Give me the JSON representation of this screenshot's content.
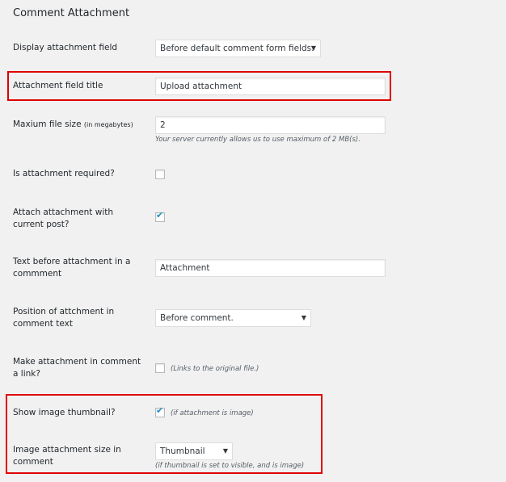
{
  "section_title": "Comment Attachment",
  "rows": {
    "display_field": {
      "label": "Display attachment field",
      "value": "Before default comment form fields."
    },
    "field_title": {
      "label": "Attachment field title",
      "value": "Upload attachment"
    },
    "max_size": {
      "label": "Maxium file size",
      "label_small": "(in megabytes)",
      "value": "2",
      "note": "Your server currently allows us to use maximum of 2 MB(s)."
    },
    "required": {
      "label": "Is attachment required?",
      "checked": false
    },
    "attach_post": {
      "label": "Attach attachment with current post?",
      "checked": true
    },
    "text_before": {
      "label": "Text before attachment in a commment",
      "value": "Attachment"
    },
    "position": {
      "label": "Position of attchment in comment text",
      "value": "Before comment."
    },
    "make_link": {
      "label": "Make attachment in comment a link?",
      "checked": false,
      "note": "(Links to the original file.)"
    },
    "show_thumb": {
      "label": "Show image thumbnail?",
      "checked": true,
      "note": "(if attachment is image)"
    },
    "image_size": {
      "label": "Image attachment size in comment",
      "value": "Thumbnail",
      "note": "(if thumbnail is set to visible, and is image)"
    }
  },
  "icons": {
    "dropdown": "▼",
    "check": "✔"
  },
  "colors": {
    "highlight": "#e00000",
    "check": "#1e8cbe"
  }
}
